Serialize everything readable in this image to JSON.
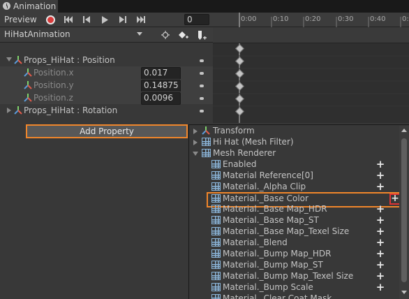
{
  "window": {
    "tab_label": "Animation"
  },
  "toolbar": {
    "preview_label": "Preview",
    "frame_value": "0"
  },
  "clip": {
    "name": "HiHatAnimation"
  },
  "timeline": {
    "ticks": [
      "0:00",
      "0:10",
      "0:20",
      "0:30",
      "0:40",
      "0:50"
    ]
  },
  "properties": {
    "position_label": "Props_HiHat : Position",
    "x_label": "Position.x",
    "x_value": "0.017",
    "y_label": "Position.y",
    "y_value": "0.14875",
    "z_label": "Position.z",
    "z_value": "0.0096",
    "rotation_label": "Props_HiHat : Rotation"
  },
  "add_property_label": "Add Property",
  "popup": {
    "groups": [
      {
        "label": "Transform"
      },
      {
        "label": "Hi Hat (Mesh Filter)"
      },
      {
        "label": "Mesh Renderer"
      }
    ],
    "items": [
      "Enabled",
      "Material Reference[0]",
      "Material._Alpha Clip",
      "Material._Base Color",
      "Material._Base Map_HDR",
      "Material._Base Map_ST",
      "Material._Base Map_Texel Size",
      "Material._Blend",
      "Material._Bump Map_HDR",
      "Material._Bump Map_ST",
      "Material._Bump Map_Texel Size",
      "Material._Bump Scale",
      "Material._Clear Coat Mask"
    ],
    "highlighted_item": "Material._Base Color",
    "plus_symbol": "+"
  },
  "colors": {
    "highlight": "#f0862b",
    "record": "#d93b3b",
    "plus_highlight": "#e03434"
  }
}
